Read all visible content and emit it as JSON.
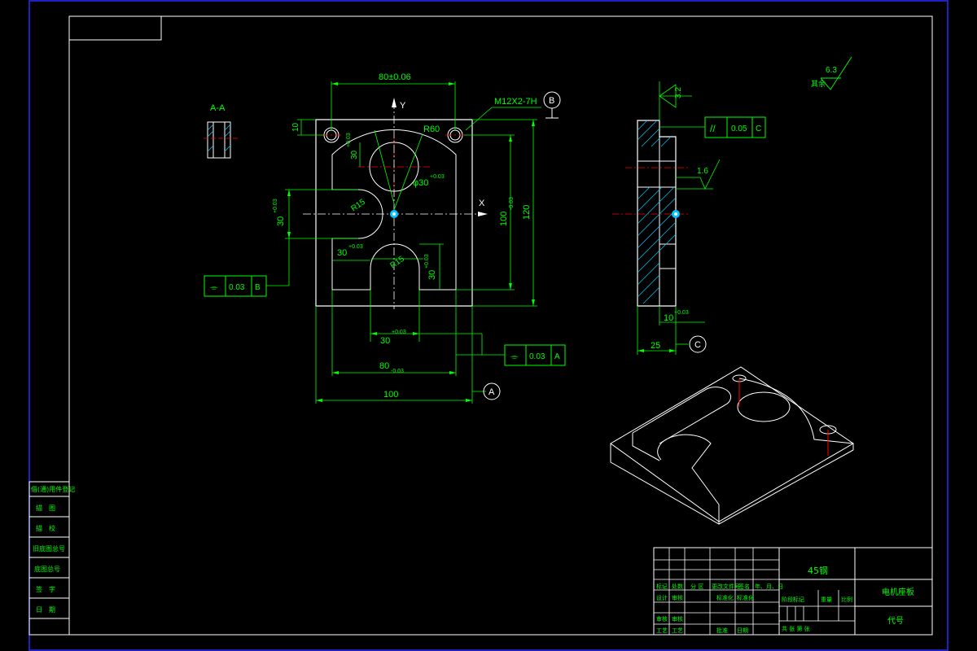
{
  "colors": {
    "background": "#000000",
    "outline": "#ffffff",
    "dimension": "#00ff00",
    "centerline": "#ff0000",
    "hatch": "#00c8ff",
    "sheet_border": "#2a2aff"
  },
  "drawing": {
    "section_label": "A-A",
    "front_view": {
      "dim_top_width": "80±0.06",
      "axis_y": "Y",
      "axis_x": "X",
      "thread_callout": "M12X2-7H",
      "datum_b": "B",
      "dim_10": "10",
      "dim_30_top": "30",
      "dim_tol_30_top": "+0.03",
      "dim_r60": "R60",
      "dim_phi30": "φ30",
      "dim_phi30_tol": "+0.03",
      "dim_r15_left": "R15",
      "dim_r15_bottom": "R15",
      "dim_30_left": "30",
      "dim_30_left_tol": "+0.03",
      "dim_30_mid": "30",
      "dim_30_mid_tol": "+0.03",
      "dim_30_slot": "30",
      "dim_30_slot_tol": "+0.03",
      "dim_100_vert": "100",
      "dim_100_vert_tol": "-0.03",
      "dim_120": "120",
      "dim_30_bottom": "30",
      "dim_30_bottom_tol": "+0.03",
      "dim_80_bottom": "80",
      "dim_80_bottom_tol": "-0.03",
      "dim_100_bottom": "100",
      "datum_a": "A"
    },
    "fcf_b": {
      "symbol": "⌯",
      "value": "0.03",
      "datum": "B"
    },
    "fcf_a": {
      "symbol": "⌯",
      "value": "0.03",
      "datum": "A"
    },
    "side_view": {
      "roughness_32": "3.2",
      "roughness_16": "1.6",
      "dim_10": "10",
      "dim_10_tol": "+0.03",
      "dim_25": "25",
      "datum_c": "C"
    },
    "fcf_c": {
      "symbol": "//",
      "value": "0.05",
      "datum": "C"
    },
    "general_roughness": {
      "value": "6.3",
      "label": "其余"
    }
  },
  "side_panel": {
    "items": [
      "借(通)用件登记",
      "描　图",
      "描　校",
      "旧底图总号",
      "底图总号",
      "签　字",
      "日　期"
    ]
  },
  "title_block": {
    "material": "45钢",
    "part_name": "电机座板",
    "code_label": "代号",
    "header_labels": [
      "标记",
      "处数",
      "分 区",
      "更改文件号",
      "签名",
      "年、月、日"
    ],
    "row_design": [
      "设计",
      "审核",
      "标准化",
      "标准化"
    ],
    "row_check": [
      "审核",
      "审核"
    ],
    "row_process": [
      "工艺",
      "工艺",
      "批准",
      "日期"
    ],
    "stage_label": "阶段标记",
    "weight_label": "重量",
    "scale_label": "比例",
    "sheet_label": "共 张 第 张"
  }
}
